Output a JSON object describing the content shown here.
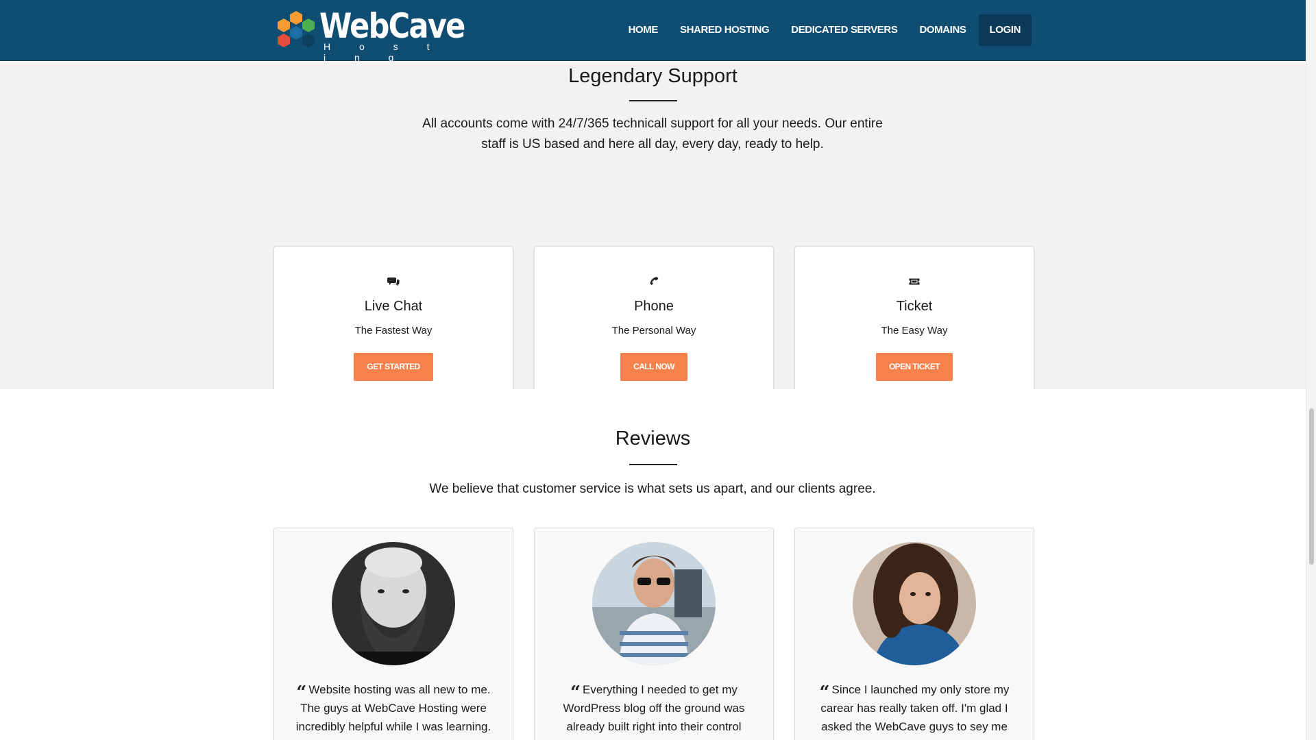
{
  "brand": {
    "name": "WebCave",
    "tagline": "H o s t i n g",
    "colors": {
      "navbar": "#0f4d72",
      "accent": "#f6814a",
      "hex_orange": "#f39c34",
      "hex_green": "#4caf50",
      "hex_red": "#e74c3c",
      "hex_blue": "#1d6fa5"
    }
  },
  "nav": {
    "items": [
      {
        "label": "HOME"
      },
      {
        "label": "SHARED HOSTING"
      },
      {
        "label": "DEDICATED SERVERS"
      },
      {
        "label": "DOMAINS"
      },
      {
        "label": "LOGIN"
      }
    ]
  },
  "support": {
    "title": "Legendary Support",
    "subtitle": "All accounts come with 24/7/365 technicall support for all your needs. Our entire staff is US based and here all day, every day, ready to help.",
    "cards": [
      {
        "icon": "chat-icon",
        "title": "Live Chat",
        "tagline": "The Fastest Way",
        "button": "GET STARTED"
      },
      {
        "icon": "phone-icon",
        "title": "Phone",
        "tagline": "The Personal Way",
        "button": "CALL NOW"
      },
      {
        "icon": "ticket-icon",
        "title": "Ticket",
        "tagline": "The Easy Way",
        "button": "OPEN TICKET"
      }
    ]
  },
  "reviews": {
    "title": "Reviews",
    "subtitle": "We believe that customer service is what sets us apart, and our clients agree.",
    "items": [
      {
        "avatar": "bearded-man-avatar",
        "text": "Website hosting was all new to me. The guys at WebCave Hosting were incredibly helpful while I was learning."
      },
      {
        "avatar": "sunglasses-man-avatar",
        "text": "Everything I needed to get my WordPress blog off the ground was already built right into their control"
      },
      {
        "avatar": "curly-hair-woman-avatar",
        "text": "Since I launched my only store my carear has really taken off. I'm glad I asked the WebCave guys to sey me"
      }
    ]
  }
}
